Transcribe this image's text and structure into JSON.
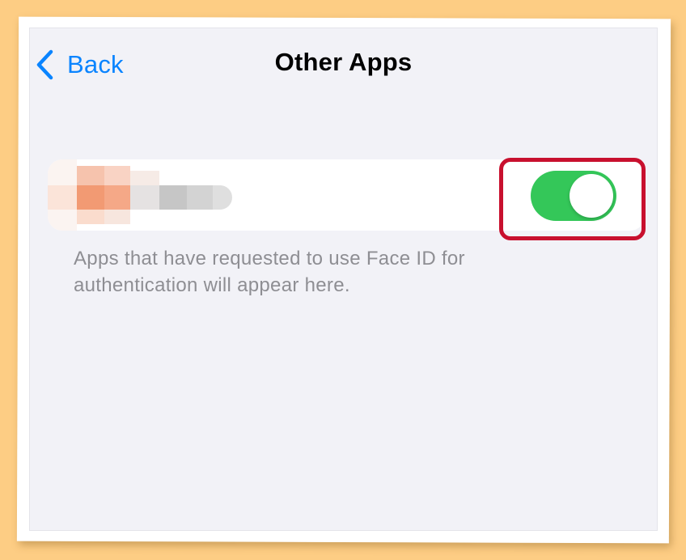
{
  "nav": {
    "back_label": "Back",
    "title": "Other Apps"
  },
  "app_row": {
    "app_icon": "blurred-app-icon",
    "toggle": {
      "state": "on",
      "on_color": "#34c759"
    }
  },
  "footnote": "Apps that have requested to use Face ID for authentication will appear here.",
  "annotation": {
    "highlight_color": "#c8102e"
  },
  "colors": {
    "accent": "#0a84ff",
    "background": "#f2f2f7",
    "frame_background": "#fdcd84"
  }
}
